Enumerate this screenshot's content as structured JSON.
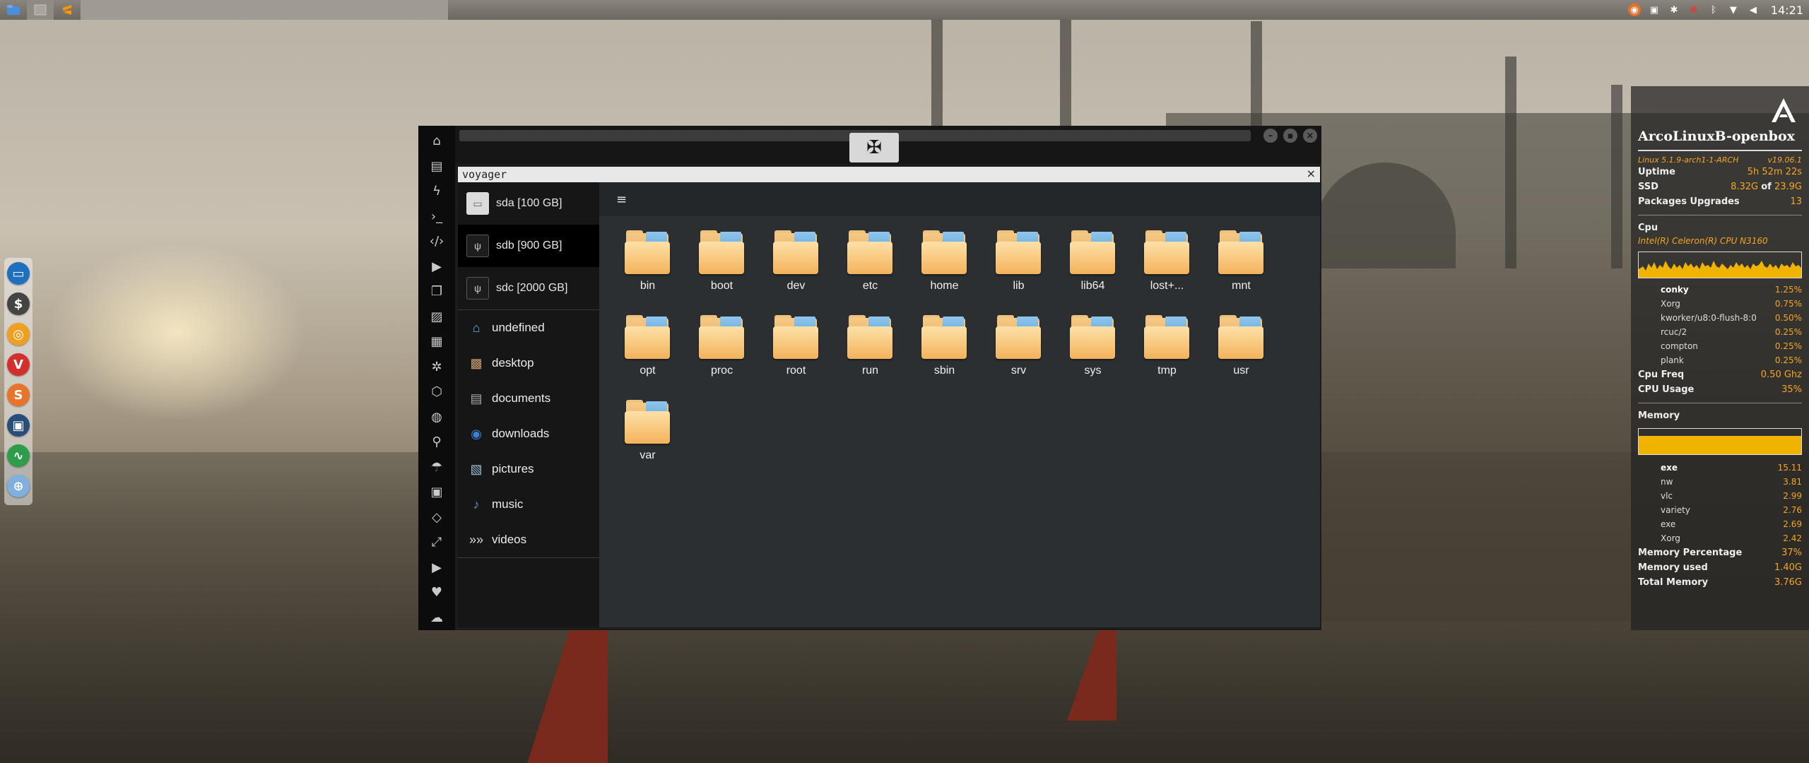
{
  "panel": {
    "clock": "14:21"
  },
  "dock": {
    "items": [
      "vivaldi-icon",
      "sublime-icon"
    ]
  },
  "file_manager": {
    "header_title": "voyager",
    "header_close": "×",
    "devices": [
      {
        "label": "sda [100 GB]",
        "selected": false
      },
      {
        "label": "sdb [900 GB]",
        "selected": true
      },
      {
        "label": "sdc [2000 GB]",
        "selected": false
      }
    ],
    "places": [
      {
        "label": "undefined",
        "icon": "home-icon"
      },
      {
        "label": "desktop",
        "icon": "desktop-icon"
      },
      {
        "label": "documents",
        "icon": "documents-icon"
      },
      {
        "label": "downloads",
        "icon": "downloads-icon"
      },
      {
        "label": "pictures",
        "icon": "pictures-icon"
      },
      {
        "label": "music",
        "icon": "music-icon"
      },
      {
        "label": "videos",
        "icon": "videos-icon"
      }
    ],
    "folders": [
      "bin",
      "boot",
      "dev",
      "etc",
      "home",
      "lib",
      "lib64",
      "lost+...",
      "mnt",
      "opt",
      "proc",
      "root",
      "run",
      "sbin",
      "srv",
      "sys",
      "tmp",
      "usr",
      "var"
    ]
  },
  "conky": {
    "hostname": "ArcoLinuxB-openbox",
    "kernel": "Linux 5.1.9-arch1-1-ARCH",
    "version": "v19.06.1",
    "uptime_label": "Uptime",
    "uptime_value": "5h 52m 22s",
    "ssd_label": "SSD",
    "ssd_used": "8.32G",
    "ssd_of": "of",
    "ssd_total": "23.9G",
    "pkg_label": "Packages Upgrades",
    "pkg_value": "13",
    "cpu_label": "Cpu",
    "cpu_model": "Intel(R) Celeron(R) CPU  N3160",
    "cpu_procs": [
      {
        "name": "conky",
        "value": "1.25%"
      },
      {
        "name": "Xorg",
        "value": "0.75%"
      },
      {
        "name": "kworker/u8:0-flush-8:0",
        "value": "0.50%"
      },
      {
        "name": "rcuc/2",
        "value": "0.25%"
      },
      {
        "name": "compton",
        "value": "0.25%"
      },
      {
        "name": "plank",
        "value": "0.25%"
      }
    ],
    "cpu_freq_label": "Cpu Freq",
    "cpu_freq_value": "0.50 Ghz",
    "cpu_usage_label": "CPU Usage",
    "cpu_usage_value": "35%",
    "memory_label": "Memory",
    "memory_fill_fraction": 1.0,
    "mem_procs": [
      {
        "name": "exe",
        "value": "15.11"
      },
      {
        "name": "nw",
        "value": "3.81"
      },
      {
        "name": "vlc",
        "value": "2.99"
      },
      {
        "name": "variety",
        "value": "2.76"
      },
      {
        "name": "exe",
        "value": "2.69"
      },
      {
        "name": "Xorg",
        "value": "2.42"
      }
    ],
    "mem_pct_label": "Memory Percentage",
    "mem_pct_value": "37%",
    "mem_used_label": "Memory used",
    "mem_used_value": "1.40G",
    "mem_total_label": "Total Memory",
    "mem_total_value": "3.76G"
  },
  "colors": {
    "accent": "#f5a623",
    "folder": "#f3b35b"
  }
}
